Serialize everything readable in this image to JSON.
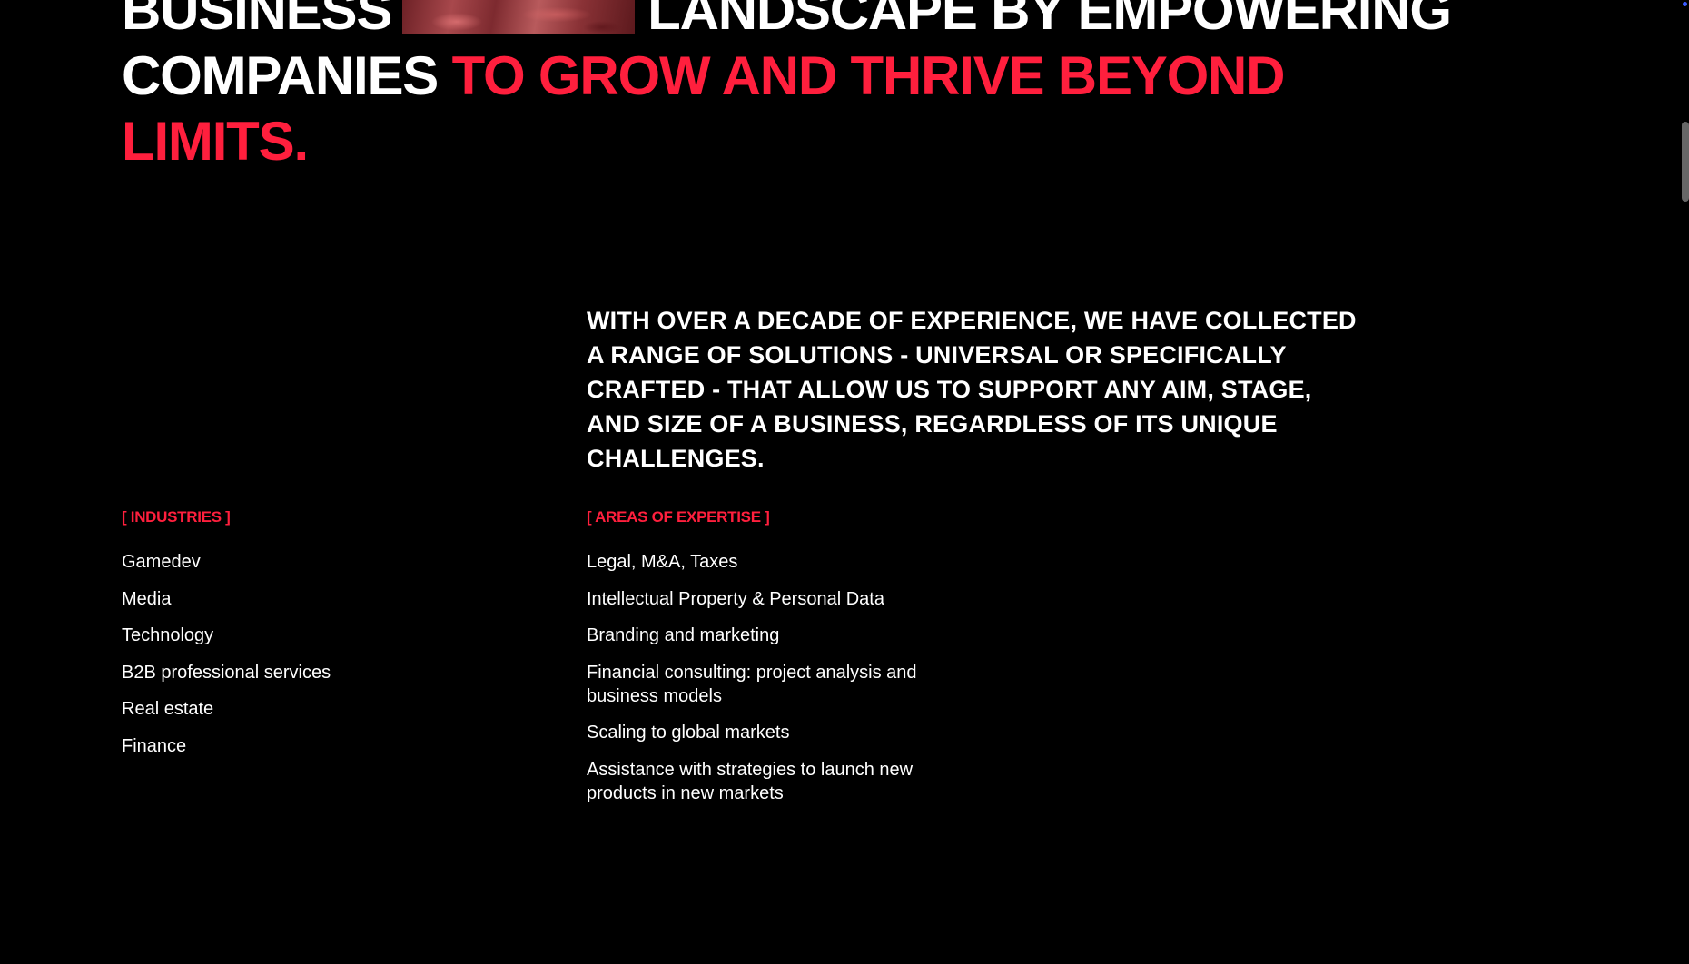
{
  "headline": {
    "line1_left": "BUSINESS",
    "line1_right": "LANDSCAPE BY EMPOWERING",
    "line2_white": "COMPANIES",
    "line2_accent": "TO GROW AND THRIVE BEYOND",
    "line3_accent": "LIMITS."
  },
  "intro": {
    "text": "WITH OVER A DECADE OF EXPERIENCE, WE HAVE COLLECTED A RANGE OF SOLUTIONS - UNIVERSAL OR SPECIFICALLY CRAFTED - THAT ALLOW US TO SUPPORT ANY AIM, STAGE, AND SIZE OF A BUSINESS, REGARDLESS OF ITS UNIQUE CHALLENGES."
  },
  "industries": {
    "heading": "[ INDUSTRIES ]",
    "items": [
      "Gamedev",
      "Media",
      "Technology",
      "B2B professional services",
      "Real estate",
      "Finance"
    ]
  },
  "expertise": {
    "heading": "[ AREAS OF EXPERTISE ]",
    "items": [
      "Legal, M&A, Taxes",
      "Intellectual Property & Personal Data",
      "Branding and marketing",
      "Financial consulting: project analysis and business models",
      "Scaling to global markets",
      "Assistance with strategies to launch new products in new markets"
    ]
  },
  "colors": {
    "background": "#000000",
    "text": "#ffffff",
    "accent": "#ff1f3d"
  }
}
